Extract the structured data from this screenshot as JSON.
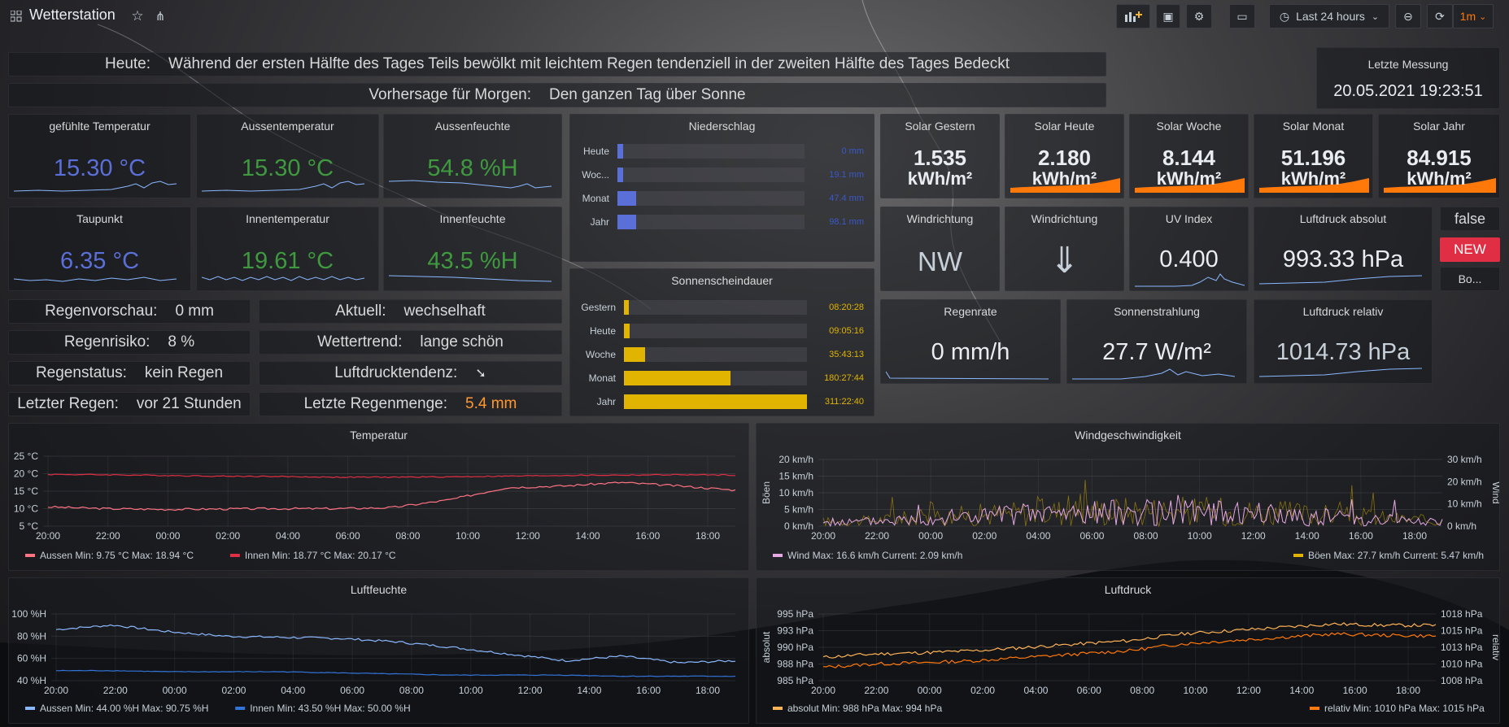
{
  "header": {
    "title": "Wetterstation",
    "time_range": "Last 24 hours",
    "refresh": "1m"
  },
  "forecast": {
    "today_label": "Heute:",
    "today_text": "Während der ersten Hälfte des Tages Teils bewölkt mit leichtem Regen tendenziell in der zweiten Hälfte des Tages Bedeckt",
    "tomorrow_label": "Vorhersage für Morgen:",
    "tomorrow_text": "Den ganzen Tag über Sonne"
  },
  "last_measurement": {
    "title": "Letzte Messung",
    "value": "20.05.2021 19:23:51"
  },
  "stats": {
    "gefuehlt": {
      "title": "gefühlte Temperatur",
      "value": "15.30 °C"
    },
    "aussen": {
      "title": "Aussentemperatur",
      "value": "15.30 °C"
    },
    "aussenfeuchte": {
      "title": "Aussenfeuchte",
      "value": "54.8 %H"
    },
    "taupunkt": {
      "title": "Taupunkt",
      "value": "6.35 °C"
    },
    "innentemp": {
      "title": "Innentemperatur",
      "value": "19.61 °C"
    },
    "innenfeuchte": {
      "title": "Innenfeuchte",
      "value": "43.5 %H"
    },
    "solar_gestern": {
      "title": "Solar Gestern",
      "value": "1.535",
      "unit": "kWh/m²"
    },
    "solar_heute": {
      "title": "Solar Heute",
      "value": "2.180",
      "unit": "kWh/m²"
    },
    "solar_woche": {
      "title": "Solar Woche",
      "value": "8.144",
      "unit": "kWh/m²"
    },
    "solar_monat": {
      "title": "Solar Monat",
      "value": "51.196",
      "unit": "kWh/m²"
    },
    "solar_jahr": {
      "title": "Solar Jahr",
      "value": "84.915",
      "unit": "kWh/m²"
    },
    "windrichtung1": {
      "title": "Windrichtung",
      "value": "NW"
    },
    "windrichtung2": {
      "title": "Windrichtung",
      "value": "⇓"
    },
    "uv": {
      "title": "UV Index",
      "value": "0.400"
    },
    "druck_abs": {
      "title": "Luftdruck absolut",
      "value": "993.33 hPa"
    },
    "regenrate": {
      "title": "Regenrate",
      "value": "0 mm/h"
    },
    "sonnenstrahlung": {
      "title": "Sonnenstrahlung",
      "value": "27.7 W/m²"
    },
    "druck_rel": {
      "title": "Luftdruck relativ",
      "value": "1014.73 hPa"
    }
  },
  "side": {
    "false_text": "false",
    "new_badge": "NEW",
    "bo_text": "Bo..."
  },
  "infos": {
    "regenvorschau": {
      "label": "Regenvorschau:",
      "value": "0 mm"
    },
    "regenrisiko": {
      "label": "Regenrisiko:",
      "value": "8 %"
    },
    "regenstatus": {
      "label": "Regenstatus:",
      "value": "kein Regen"
    },
    "letzter_regen": {
      "label": "Letzter Regen:",
      "value": "vor 21 Stunden"
    },
    "aktuell": {
      "label": "Aktuell:",
      "value": "wechselhaft"
    },
    "wettertrend": {
      "label": "Wettertrend:",
      "value": "lange schön"
    },
    "luftdrucktendenz": {
      "label": "Luftdrucktendenz:",
      "value": "➘"
    },
    "letzte_regenmenge": {
      "label": "Letzte Regenmenge:",
      "value": "5.4 mm"
    }
  },
  "niederschlag": {
    "title": "Niederschlag",
    "rows": [
      {
        "label": "Heute",
        "value": "0 mm",
        "fill": 0.03
      },
      {
        "label": "Woc...",
        "value": "19.1 mm",
        "fill": 0.03
      },
      {
        "label": "Monat",
        "value": "47.4 mm",
        "fill": 0.1
      },
      {
        "label": "Jahr",
        "value": "98.1 mm",
        "fill": 0.1
      }
    ]
  },
  "sonnenschein": {
    "title": "Sonnenscheindauer",
    "rows": [
      {
        "label": "Gestern",
        "value": "08:20:28",
        "fill": 0.027
      },
      {
        "label": "Heute",
        "value": "09:05:16",
        "fill": 0.029
      },
      {
        "label": "Woche",
        "value": "35:43:13",
        "fill": 0.115
      },
      {
        "label": "Monat",
        "value": "180:27:44",
        "fill": 0.58
      },
      {
        "label": "Jahr",
        "value": "311:22:40",
        "fill": 1.0
      }
    ]
  },
  "colors": {
    "blue": "#5b6fd8",
    "green": "#3f9a3f",
    "orange": "#ff780a",
    "yellow": "#e0b400",
    "red": "#e02f44",
    "pink": "#e5a8e2",
    "lightblue": "#8ab8ff"
  },
  "chart_data": [
    {
      "type": "line",
      "title": "Temperatur",
      "x": [
        "20:00",
        "22:00",
        "00:00",
        "02:00",
        "04:00",
        "06:00",
        "08:00",
        "10:00",
        "12:00",
        "14:00",
        "16:00",
        "18:00"
      ],
      "yticks": [
        "5 °C",
        "10 °C",
        "15 °C",
        "20 °C",
        "25 °C"
      ],
      "ylim": [
        5,
        25
      ],
      "series": [
        {
          "name": "Aussen",
          "color": "#ff7383",
          "values": [
            10.5,
            10.0,
            9.8,
            9.9,
            10.0,
            10.0,
            10.3,
            12.5,
            16.0,
            16.5,
            17.5,
            16.5,
            15.3
          ]
        },
        {
          "name": "Innen",
          "color": "#e02f44",
          "values": [
            19.8,
            19.7,
            19.5,
            19.3,
            19.2,
            19.0,
            19.0,
            19.1,
            19.3,
            19.5,
            19.6,
            19.7,
            19.6
          ]
        }
      ],
      "legend": [
        {
          "name": "Aussen",
          "stats": "Min: 9.75 °C  Max: 18.94 °C"
        },
        {
          "name": "Innen",
          "stats": "Min: 18.77 °C  Max: 20.17 °C"
        }
      ]
    },
    {
      "type": "line",
      "title": "Windgeschwindigkeit",
      "x": [
        "20:00",
        "22:00",
        "00:00",
        "02:00",
        "04:00",
        "06:00",
        "08:00",
        "10:00",
        "12:00",
        "14:00",
        "16:00",
        "18:00"
      ],
      "yticks_left": [
        "0 km/h",
        "5 km/h",
        "10 km/h",
        "15 km/h",
        "20 km/h"
      ],
      "yticks_right": [
        "0 km/h",
        "10 km/h",
        "20 km/h",
        "30 km/h"
      ],
      "ylabel_left": "Böen",
      "ylabel_right": "Wind",
      "series": [
        {
          "name": "Wind",
          "color": "#e5a8e2",
          "max": 16.6,
          "current": 2.09
        },
        {
          "name": "Böen",
          "color": "#e0b400",
          "max": 27.7,
          "current": 5.47
        }
      ],
      "legend": [
        {
          "name": "Wind",
          "stats": "Max: 16.6 km/h  Current: 2.09 km/h"
        },
        {
          "name": "Böen",
          "stats": "Max: 27.7 km/h  Current: 5.47 km/h"
        }
      ]
    },
    {
      "type": "line",
      "title": "Luftfeuchte",
      "x": [
        "20:00",
        "22:00",
        "00:00",
        "02:00",
        "04:00",
        "06:00",
        "08:00",
        "10:00",
        "12:00",
        "14:00",
        "16:00",
        "18:00"
      ],
      "yticks": [
        "40 %H",
        "60 %H",
        "80 %H",
        "100 %H"
      ],
      "ylim": [
        40,
        100
      ],
      "series": [
        {
          "name": "Aussen",
          "color": "#8ab8ff",
          "values": [
            86,
            90,
            84,
            80,
            79,
            78,
            75,
            70,
            64,
            58,
            62,
            56,
            58
          ]
        },
        {
          "name": "Innen",
          "color": "#3274d9",
          "values": [
            49,
            49,
            48,
            48,
            48,
            47,
            46,
            45,
            45,
            45,
            44,
            44,
            44
          ]
        }
      ],
      "legend": [
        {
          "name": "Aussen",
          "stats": "Min: 44.00 %H  Max: 90.75 %H"
        },
        {
          "name": "Innen",
          "stats": "Min: 43.50 %H  Max: 50.00 %H"
        }
      ]
    },
    {
      "type": "line",
      "title": "Luftdruck",
      "x": [
        "20:00",
        "22:00",
        "00:00",
        "02:00",
        "04:00",
        "06:00",
        "08:00",
        "10:00",
        "12:00",
        "14:00",
        "16:00",
        "18:00"
      ],
      "yticks_left": [
        "985 hPa",
        "988 hPa",
        "990 hPa",
        "993 hPa",
        "995 hPa"
      ],
      "yticks_right": [
        "1008 hPa",
        "1010 hPa",
        "1013 hPa",
        "1015 hPa",
        "1018 hPa"
      ],
      "ylabel_left": "absolut",
      "ylabel_right": "relativ",
      "series": [
        {
          "name": "absolut",
          "color": "#ffb357",
          "values": [
            988.5,
            989,
            989.2,
            989.5,
            990,
            990.5,
            991,
            992,
            992.5,
            993,
            993.5,
            993.3,
            993.3
          ]
        },
        {
          "name": "relativ",
          "color": "#ff780a",
          "values": [
            1010,
            1010.5,
            1010.7,
            1011,
            1011.5,
            1012,
            1012.5,
            1013.5,
            1014,
            1014.5,
            1015,
            1014.8,
            1014.7
          ]
        }
      ],
      "legend": [
        {
          "name": "absolut",
          "stats": "Min: 988 hPa  Max: 994 hPa"
        },
        {
          "name": "relativ",
          "stats": "Min: 1010 hPa  Max: 1015 hPa"
        }
      ]
    }
  ]
}
